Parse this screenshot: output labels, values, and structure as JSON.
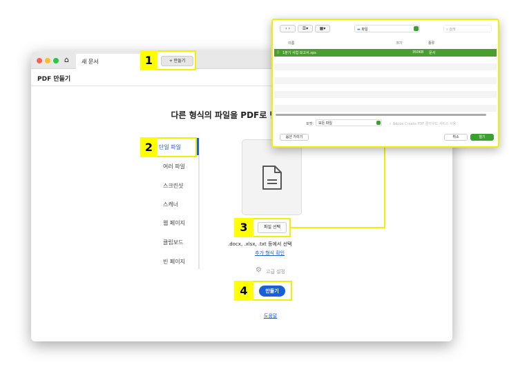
{
  "window": {
    "tab_title": "새 문서",
    "header_title": "PDF 만들기",
    "heading": "다른 형식의 파일을 PDF로 변환",
    "new_button": "+ 만들기"
  },
  "sidebar": {
    "items": [
      {
        "label": "단일 파일",
        "active": true
      },
      {
        "label": "여러 파일"
      },
      {
        "label": "스크린샷"
      },
      {
        "label": "스캐너"
      },
      {
        "label": "웹 페이지"
      },
      {
        "label": "클립보드"
      },
      {
        "label": "빈 페이지"
      }
    ]
  },
  "main": {
    "select_file": "파일 선택",
    "formats_hint": ".docx, .xlsx, .txt 등에서 선택",
    "more_formats_link": "추가 형식 확인",
    "advanced": "고급 설정",
    "create": "만들기",
    "help": "도움말"
  },
  "callouts": [
    "1",
    "2",
    "3",
    "4"
  ],
  "dialog": {
    "folder": "파일",
    "search_placeholder": "검색",
    "columns": {
      "name": "이름",
      "size": "크기",
      "kind": "종류"
    },
    "files": [
      {
        "name": "1분기 사업 보고서.xps",
        "size": "350KB",
        "kind": "문서"
      }
    ],
    "format_label": "포맷:",
    "format_value": "모든 파일",
    "cloud_option": "Adobe Create PDF 클라우드 서비스 사용",
    "hide_options": "옵션 가리기",
    "cancel": "취소",
    "open": "열기"
  },
  "colors": {
    "accent": "#1a5fd8",
    "highlight": "#ffff00",
    "selected_row": "#4a9e2f"
  }
}
